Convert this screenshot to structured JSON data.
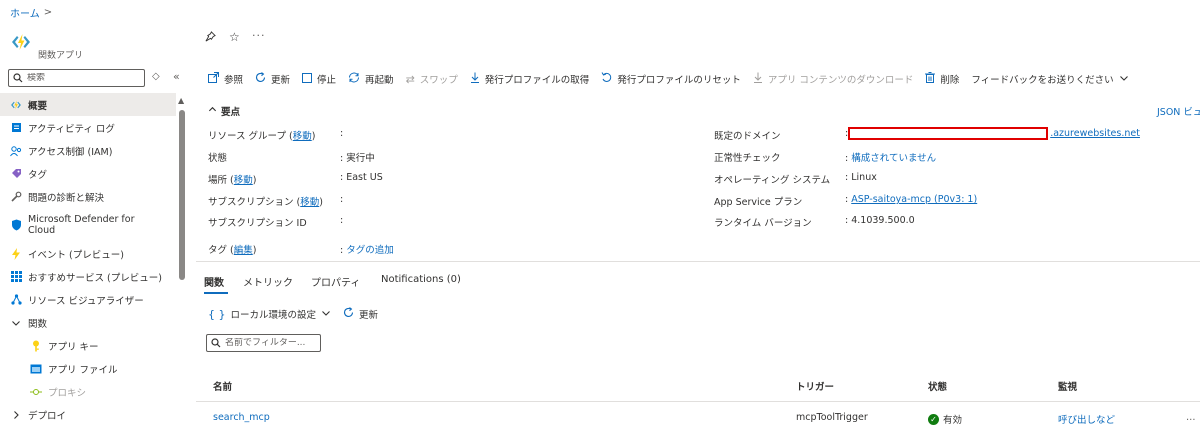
{
  "breadcrumb": {
    "home": "ホーム",
    "sep": ">"
  },
  "resource": {
    "type": "関数アプリ"
  },
  "header": {
    "pin": "⊿",
    "star": "☆",
    "more": "···"
  },
  "sidebar": {
    "search_placeholder": "検索",
    "filter_glyph": "◇",
    "collapse_glyph": "«",
    "items": [
      {
        "label": "概要",
        "icon": "function-icon"
      },
      {
        "label": "アクティビティ ログ",
        "icon": "activity-log-icon"
      },
      {
        "label": "アクセス制御 (IAM)",
        "icon": "iam-icon"
      },
      {
        "label": "タグ",
        "icon": "tag-icon"
      },
      {
        "label": "問題の診断と解決",
        "icon": "wrench-icon"
      },
      {
        "label": "Microsoft Defender for Cloud",
        "icon": "shield-icon"
      },
      {
        "label": "イベント (プレビュー)",
        "icon": "lightning-icon"
      },
      {
        "label": "おすすめサービス (プレビュー)",
        "icon": "grid-icon"
      },
      {
        "label": "リソース ビジュアライザー",
        "icon": "visualizer-icon"
      },
      {
        "label": "関数",
        "icon": "chevron-down-icon"
      },
      {
        "label": "アプリ キー",
        "icon": "key-icon"
      },
      {
        "label": "アプリ ファイル",
        "icon": "file-icon"
      },
      {
        "label": "プロキシ",
        "icon": "proxy-icon"
      },
      {
        "label": "デプロイ",
        "icon": "chevron-right-icon"
      }
    ]
  },
  "toolbar": {
    "browse": "参照",
    "refresh": "更新",
    "stop": "停止",
    "restart": "再起動",
    "swap": "スワップ",
    "get_profile": "発行プロファイルの取得",
    "reset_profile": "発行プロファイルのリセット",
    "download": "アプリ コンテンツのダウンロード",
    "delete": "削除",
    "feedback": "フィードバックをお送りください"
  },
  "essentials": {
    "title": "要点",
    "json_view": "JSON ビュ",
    "colon": ":",
    "resource_group": {
      "label": "リソース グループ",
      "link": "移動",
      "value": ""
    },
    "status": {
      "label": "状態",
      "value": "実行中"
    },
    "location": {
      "label": "場所",
      "link": "移動",
      "value": "East US"
    },
    "subscription": {
      "label": "サブスクリプション",
      "link": "移動",
      "value": ""
    },
    "subscription_id": {
      "label": "サブスクリプション ID",
      "value": ""
    },
    "tags": {
      "label": "タグ",
      "link": "編集",
      "value": "タグの追加"
    },
    "default_domain": {
      "label": "既定のドメイン",
      "value": ".azurewebsites.net"
    },
    "health_check": {
      "label": "正常性チェック",
      "value": "構成されていません"
    },
    "os": {
      "label": "オペレーティング システム",
      "value": "Linux"
    },
    "plan": {
      "label": "App Service プラン",
      "value": "ASP-saitoya-mcp (P0v3: 1)"
    },
    "runtime": {
      "label": "ランタイム バージョン",
      "value": "4.1039.500.0"
    }
  },
  "tabs": [
    {
      "label": "関数"
    },
    {
      "label": "メトリック"
    },
    {
      "label": "プロパティ"
    },
    {
      "label": "Notifications (0)"
    }
  ],
  "functions": {
    "local_env": "ローカル環境の設定",
    "refresh": "更新",
    "filter_placeholder": "名前でフィルター...",
    "columns": {
      "name": "名前",
      "trigger": "トリガー",
      "status": "状態",
      "monitor": "監視"
    },
    "rows": [
      {
        "name": "search_mcp",
        "trigger": "mcpToolTrigger",
        "status": "有効",
        "monitor": "呼び出しなど",
        "more": "…"
      }
    ]
  },
  "colors": {
    "accent": "#0f6cbd",
    "danger": "#e00000",
    "success": "#107c10"
  }
}
